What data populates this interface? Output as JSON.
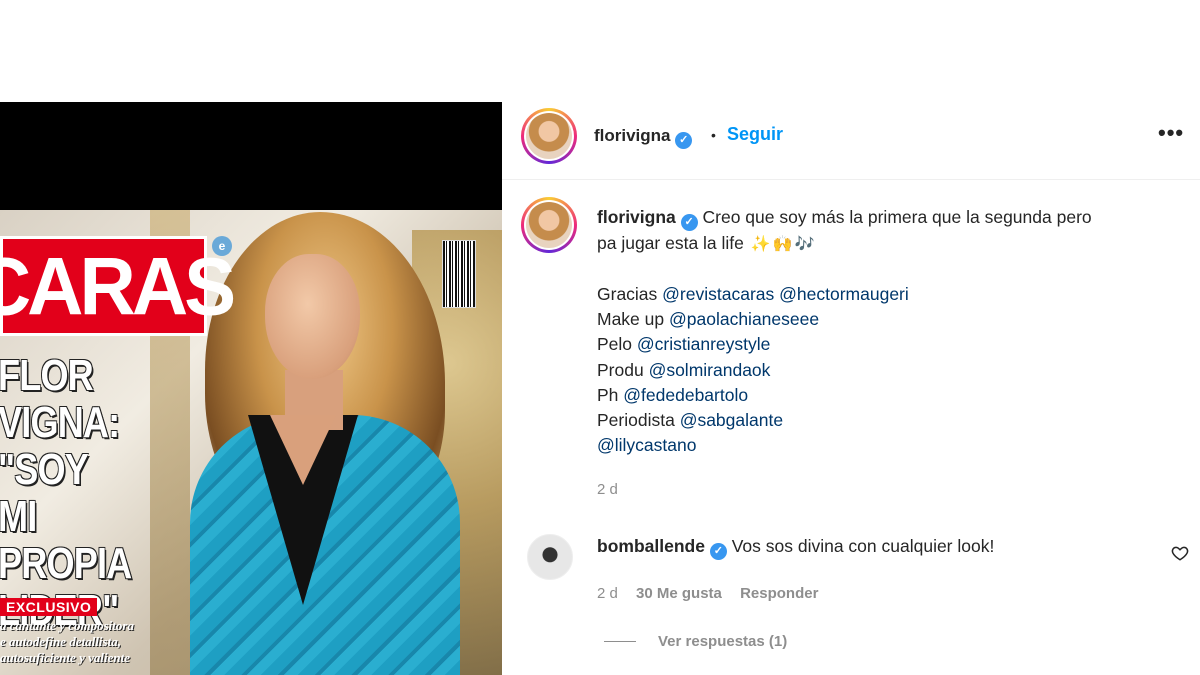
{
  "post": {
    "username": "florivigna",
    "separator": "•",
    "follow_label": "Seguir",
    "more_label": "•••"
  },
  "cover": {
    "logo": "CARAS",
    "headline": [
      "FLOR",
      "VIGNA:",
      "\"SOY MI",
      "PROPIA",
      "LIDER\""
    ],
    "badge": "EXCLUSIVO",
    "subtext": [
      "a cantante y compositora",
      "e autodefine detallista,",
      "autosuficiente y valiente"
    ]
  },
  "caption": {
    "username": "florivigna",
    "text_line1": "Creo que soy más la primera que la segunda pero",
    "text_line2": "pa jugar esta la life",
    "emojis": [
      "sparkle-emoji",
      "hands-emoji",
      "music-emoji"
    ],
    "credits": [
      {
        "prefix": "Gracias ",
        "mentions": [
          "@revistacaras",
          "@hectormaugeri"
        ]
      },
      {
        "prefix": "Make up ",
        "mentions": [
          "@paolachianeseee"
        ]
      },
      {
        "prefix": "Pelo ",
        "mentions": [
          "@cristianreystyle"
        ]
      },
      {
        "prefix": "Produ ",
        "mentions": [
          "@solmirandaok"
        ]
      },
      {
        "prefix": "Ph ",
        "mentions": [
          "@fededebartolo"
        ]
      },
      {
        "prefix": "Periodista ",
        "mentions": [
          "@sabgalante"
        ]
      },
      {
        "prefix": "",
        "mentions": [
          "@lilycastano"
        ]
      }
    ],
    "time": "2 d"
  },
  "comment": {
    "username": "bomballende",
    "text": "Vos sos divina con cualquier look!",
    "time": "2 d",
    "likes": "30 Me gusta",
    "reply_label": "Responder",
    "view_replies": "Ver respuestas (1)"
  },
  "colors": {
    "accent": "#0095f6",
    "verified": "#3897f0",
    "mention": "#00376b",
    "muted": "#8e8e8e",
    "caras_red": "#e2001a"
  }
}
